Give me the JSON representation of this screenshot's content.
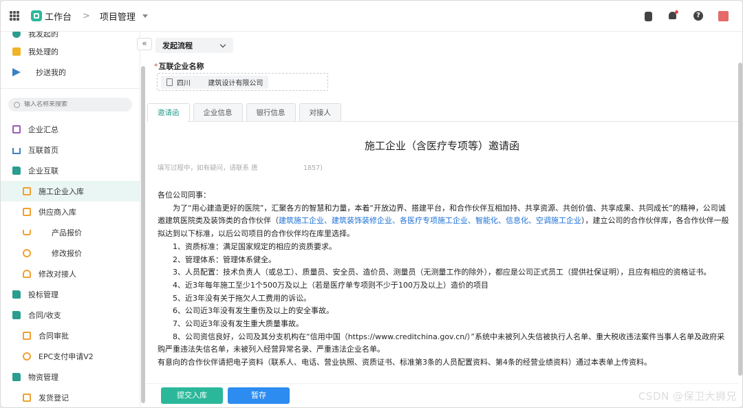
{
  "header": {
    "app_title": "工作台",
    "breadcrumb_sep": ">",
    "breadcrumb": "项目管理"
  },
  "sidebar": {
    "items_top": [
      {
        "label": "我发起的"
      },
      {
        "label": "我处理的"
      },
      {
        "label": "抄送我的"
      }
    ],
    "search_placeholder": "输入名称来搜索",
    "items": [
      {
        "label": "企业汇总"
      },
      {
        "label": "互联首页"
      },
      {
        "label": "企业互联"
      },
      {
        "label": "施工企业入库"
      },
      {
        "label": "供应商入库"
      },
      {
        "label": "产品报价"
      },
      {
        "label": "修改报价"
      },
      {
        "label": "修改对接人"
      },
      {
        "label": "投标管理"
      },
      {
        "label": "合同/收支"
      },
      {
        "label": "合同审批"
      },
      {
        "label": "EPC支付申请V2"
      },
      {
        "label": "物资管理"
      },
      {
        "label": "发货登记"
      }
    ],
    "collapse_glyph": "«"
  },
  "main": {
    "start_flow": "发起流程",
    "field_label": "互联企业名称",
    "required_mark": "*",
    "company_name": "四川        建筑设计有限公司",
    "tabs": [
      {
        "label": "邀请函"
      },
      {
        "label": "企业信息"
      },
      {
        "label": "银行信息"
      },
      {
        "label": "对接人"
      }
    ],
    "letter_title": "施工企业（含医疗专项等）邀请函",
    "hint": "填写过程中，如有疑问，请联系 唐                      1857)",
    "greeting": "各位公司同事：",
    "para1_a": "为了“用心建造更好的医院”，汇聚各方的智慧和力量，本着“开放边界、搭建平台，和合作伙伴互相加持、共享资源、共创价值、共享成果、共同成长”的精神，公司诚邀建筑医院类及装饰类的合作伙伴（",
    "para1_link": "建筑施工企业、建筑装饰装修企业、各医疗专项施工企业、智能化、信息化、空调施工企业",
    "para1_b": "），建立公司的合作伙伴库，各合作伙伴一般拟达到以下标准，以后公司项目的合作伙伴均在库里选择。",
    "items": [
      "1、资质标准：满足国家规定的相应的资质要求。",
      "2、管理体系：管理体系健全。",
      "3、人员配置：技术负责人（或总工）、质量员、安全员、造价员、测量员（无测量工作的除外），都应是公司正式员工（提供社保证明），且应有相应的资格证书。",
      "4、近3年每年施工至少1个500万及以上（若是医疗单专项则不少于100万及以上）造价的项目",
      "5、近3年没有关于拖欠人工费用的诉讼。",
      "6、公司近3年没有发生重伤及以上的安全事故。",
      "7、公司近3年没有发生重大质量事故。",
      "8、公司资信良好，公司及其分支机构在“信用中国（https://www.creditchina.gov.cn/）”系统中未被列入失信被执行人名单、重大税收违法案件当事人名单及政府采购严重违法失信名单，未被列入经营异常名录、严重违法企业名单。"
    ],
    "closing": "有意向的合作伙伴请把电子资料（联系人、电话、营业执照、资质证书、标准第3条的人员配置资料、第4条的经营业绩资料）通过本表单上传资料。",
    "submit_label": "提交入库",
    "save_label": "暂存"
  },
  "watermark": "CSDN @保卫大狮兄",
  "colors": {
    "accent": "#2bb89a",
    "primary": "#2d8cf0",
    "link": "#1a6fd6"
  }
}
